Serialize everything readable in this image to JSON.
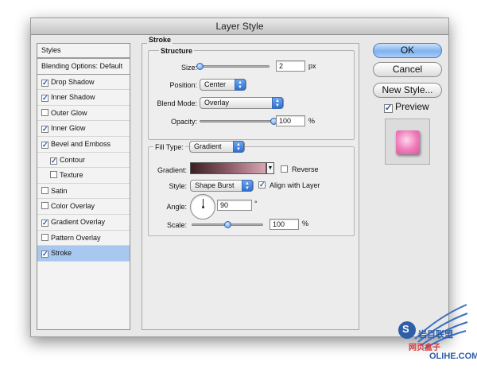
{
  "window": {
    "title": "Layer Style"
  },
  "styles_list": {
    "header": "Styles",
    "blending": "Blending Options: Default",
    "items": [
      {
        "label": "Drop Shadow",
        "checked": true
      },
      {
        "label": "Inner Shadow",
        "checked": true
      },
      {
        "label": "Outer Glow",
        "checked": false
      },
      {
        "label": "Inner Glow",
        "checked": true
      },
      {
        "label": "Bevel and Emboss",
        "checked": true
      },
      {
        "label": "Contour",
        "checked": true
      },
      {
        "label": "Texture",
        "checked": false
      },
      {
        "label": "Satin",
        "checked": false
      },
      {
        "label": "Color Overlay",
        "checked": false
      },
      {
        "label": "Gradient Overlay",
        "checked": true
      },
      {
        "label": "Pattern Overlay",
        "checked": false
      },
      {
        "label": "Stroke",
        "checked": true,
        "selected": true
      }
    ]
  },
  "stroke": {
    "title": "Stroke",
    "structure": {
      "title": "Structure",
      "size_label": "Size:",
      "size_value": "2",
      "size_unit": "px",
      "size_slider_fraction": 0.0,
      "position_label": "Position:",
      "position_value": "Center",
      "blend_label": "Blend Mode:",
      "blend_value": "Overlay",
      "opacity_label": "Opacity:",
      "opacity_value": "100",
      "opacity_unit": "%",
      "opacity_slider_fraction": 1.0
    },
    "fill": {
      "type_label": "Fill Type:",
      "type_value": "Gradient",
      "gradient_label": "Gradient:",
      "reverse_label": "Reverse",
      "reverse_checked": false,
      "style_label": "Style:",
      "style_value": "Shape Burst",
      "align_label": "Align with Layer",
      "align_checked": true,
      "angle_label": "Angle:",
      "angle_value": "90",
      "angle_unit": "°",
      "scale_label": "Scale:",
      "scale_value": "100",
      "scale_unit": "%",
      "scale_slider_fraction": 0.5
    }
  },
  "buttons": {
    "ok": "OK",
    "cancel": "Cancel",
    "new_style": "New Style...",
    "preview_label": "Preview",
    "preview_checked": true
  },
  "watermark": {
    "line1": "岩目联盟",
    "line2": "网页盒子",
    "line3": "OLIHE.COM",
    "badge": "S"
  },
  "colors": {
    "selected_row": "#a9c8ef",
    "default_button": "#7fb2ef",
    "gradient_start": "#3c1f24",
    "gradient_end": "#d9a6b2",
    "preview_swatch": "#ee79b8"
  }
}
